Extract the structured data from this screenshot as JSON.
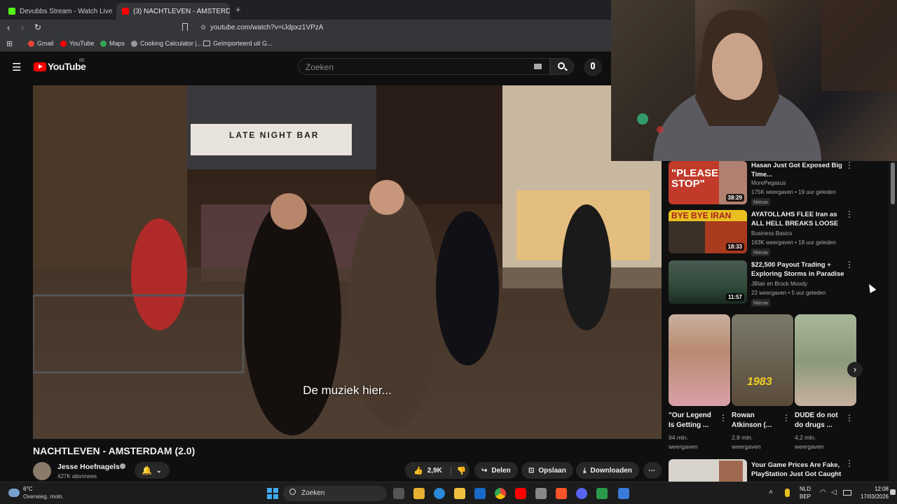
{
  "browser": {
    "tabs": [
      {
        "title": "Devubbs Stream - Watch Live on",
        "active": false
      },
      {
        "title": "(3) NACHTLEVEN - AMSTERD",
        "active": true
      }
    ],
    "url": "youtube.com/watch?v=iJdpxz1VPzA",
    "bookmarks": [
      "Gmail",
      "YouTube",
      "Maps",
      "Cooking Calculator |...",
      "Geïmporteerd uit G..."
    ]
  },
  "youtube": {
    "logo": "YouTube",
    "region": "BE",
    "search_placeholder": "Zoeken"
  },
  "video": {
    "caption": "De muziek hier...",
    "sign_text": "LATE NIGHT BAR",
    "title": "NACHTLEVEN - AMSTERDAM (2.0)",
    "channel": "Jesse Hoefnagels",
    "subscribers": "427K abonnees",
    "likes": "2,9K",
    "share": "Delen",
    "save": "Opslaan",
    "download": "Downloaden"
  },
  "sidebar": {
    "videos": [
      {
        "title": "Hasan Just Got Exposed Big Time...",
        "channel": "MorePegasus",
        "meta": "175K weergaven • 19 uur geleden",
        "badge": "Nieuw",
        "duration": "38:29",
        "thumb_text": "\"PLEASE STOP\"",
        "thumb_color": "#c23a2a"
      },
      {
        "title": "AYATOLLAHS FLEE Iran as ALL HELL BREAKS LOOSE",
        "channel": "Business Basics",
        "meta": "163K weergaven • 18 uur geleden",
        "badge": "Nieuw",
        "duration": "18:33",
        "thumb_text": "BYE BYE IRAN",
        "thumb_color": "#a83a1e"
      },
      {
        "title": "$22,500 Payout Trading + Exploring Storms in Paradise",
        "channel": "JBlair en Brock Moody",
        "meta": "22 weergaven • 5 uur geleden",
        "badge": "Nieuw",
        "duration": "11:57",
        "thumb_text": "",
        "thumb_color": "#2f4a3a"
      },
      {
        "title": "Your Game Prices Are Fake, PlayStation Just Got Caught",
        "channel": "",
        "meta": "",
        "badge": "",
        "duration": "",
        "thumb_text": "",
        "thumb_color": "#d8d4cc"
      }
    ],
    "shorts": [
      {
        "title": "\"Our Legend Is Getting ...",
        "views": "94 mln. weergaven",
        "thumb_text": "",
        "thumb_color": "#b98a70"
      },
      {
        "title": "Rowan Atkinson (...",
        "views": "2,8 mln. weergaven",
        "thumb_text": "1983",
        "thumb_color": "#5a4a3a"
      },
      {
        "title": "DUDE do not do drugs ...",
        "views": "4,2 mln. weergaven",
        "thumb_text": "",
        "thumb_color": "#8a9a7a"
      }
    ]
  },
  "taskbar": {
    "weather_temp": "6°C",
    "weather_desc": "Overwieg. moln.",
    "search": "Zoeken",
    "lang1": "NLD",
    "lang2": "BEP",
    "time": "12:08",
    "date": "17/03/2026"
  }
}
